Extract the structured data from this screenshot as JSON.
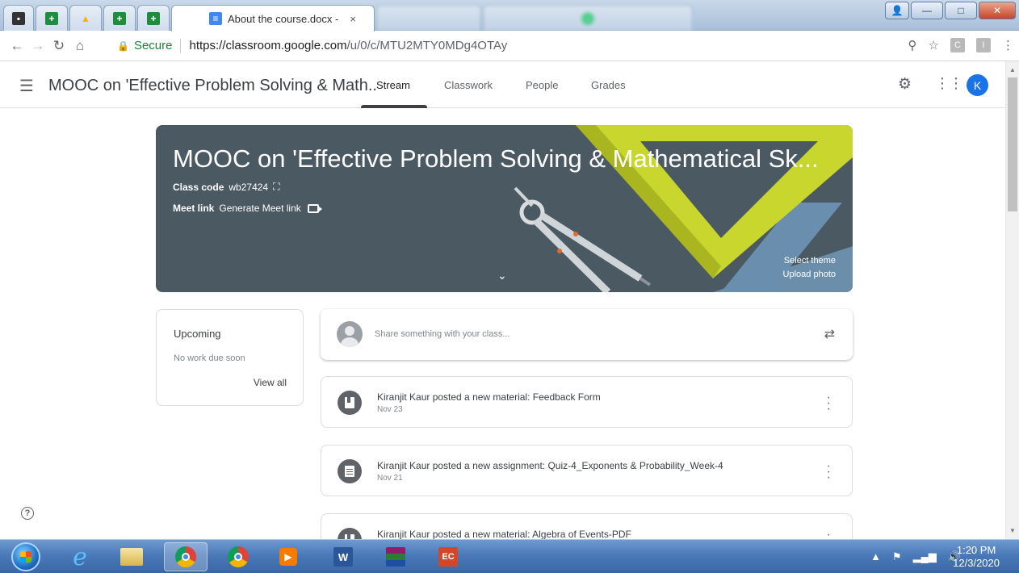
{
  "browser": {
    "tabs": [
      {
        "icon": "classroom-icon",
        "title": ""
      },
      {
        "icon": "sheets-icon",
        "title": ""
      },
      {
        "icon": "drive-icon",
        "title": ""
      },
      {
        "icon": "sheets-icon",
        "title": ""
      },
      {
        "icon": "sheets-icon",
        "title": ""
      },
      {
        "icon": "docs-icon",
        "title": "About the course.docx -"
      },
      {
        "icon": "blank-icon",
        "title": ""
      },
      {
        "icon": "whatsapp-icon",
        "title": ""
      }
    ],
    "close_glyph": "×",
    "secure_label": "Secure",
    "url_host": "https://classroom.google.com",
    "url_path": "/u/0/c/MTU2MTY0MDg4OTAy",
    "extensions": [
      "C",
      "I"
    ]
  },
  "header": {
    "course_title": "MOOC on 'Effective Problem Solving & Math..",
    "tabs": {
      "stream": "Stream",
      "classwork": "Classwork",
      "people": "People",
      "grades": "Grades"
    },
    "avatar_initial": "K"
  },
  "banner": {
    "title": "MOOC on 'Effective Problem Solving & Mathematical Sk...",
    "class_code_label": "Class code",
    "class_code": "wb27424",
    "meet_label": "Meet link",
    "meet_action": "Generate Meet link",
    "select_theme": "Select theme",
    "upload_photo": "Upload photo"
  },
  "upcoming": {
    "title": "Upcoming",
    "subtitle": "No work due soon",
    "view_all": "View all"
  },
  "share": {
    "placeholder": "Share something with your class..."
  },
  "posts": [
    {
      "icon": "material-icon",
      "title": "Kiranjit Kaur posted a new material: Feedback Form",
      "date": "Nov 23"
    },
    {
      "icon": "assignment-icon",
      "title": "Kiranjit Kaur posted a new assignment: Quiz-4_Exponents & Probability_Week-4",
      "date": "Nov 21"
    },
    {
      "icon": "material-icon",
      "title": "Kiranjit Kaur posted a new material: Algebra of Events-PDF",
      "date": ""
    }
  ],
  "help_glyph": "?",
  "taskbar": {
    "time": "1:20 PM",
    "date": "12/3/2020"
  },
  "colors": {
    "banner": "#4b5962",
    "accent": "#1a73e8",
    "secure": "#188038"
  }
}
